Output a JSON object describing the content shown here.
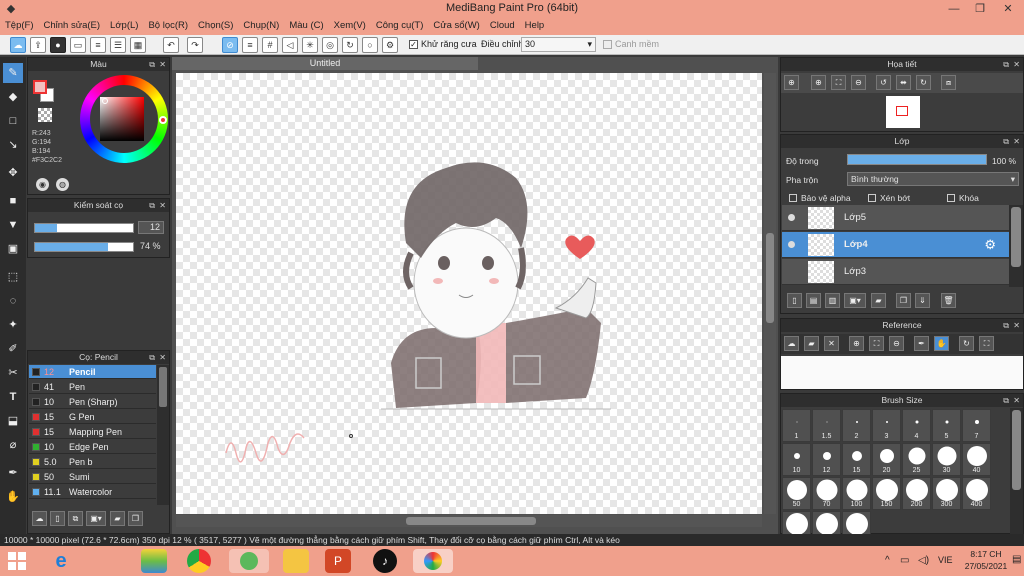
{
  "window": {
    "title": "MediBang Paint Pro (64bit)"
  },
  "menu": [
    "Tệp(F)",
    "Chỉnh sửa(E)",
    "Lớp(L)",
    "Bộ lọc(R)",
    "Chọn(S)",
    "Chụp(N)",
    "Màu (C)",
    "Xem(V)",
    "Công cụ(T)",
    "Cửa sổ(W)",
    "Cloud",
    "Help"
  ],
  "toolbar": {
    "antialias_label": "Khử răng cưa",
    "adjust_label": "Điều chỉnh",
    "adjust_value": "30",
    "smooth_label": "Canh mềm"
  },
  "color_panel": {
    "title": "Màu",
    "r": "R:243",
    "g": "G:194",
    "b": "B:194",
    "hex": "#F3C2C2",
    "fg": "#f3c2c2"
  },
  "brush_control": {
    "title": "Kiểm soát cọ",
    "size": "12",
    "opacity": "74 %"
  },
  "brush_panel": {
    "title": "Cọ: Pencil",
    "items": [
      {
        "size": "12",
        "name": "Pencil",
        "color": "#222222"
      },
      {
        "size": "41",
        "name": "Pen",
        "color": "#222222"
      },
      {
        "size": "10",
        "name": "Pen (Sharp)",
        "color": "#222222"
      },
      {
        "size": "15",
        "name": "G Pen",
        "color": "#e03030"
      },
      {
        "size": "15",
        "name": "Mapping Pen",
        "color": "#e03030"
      },
      {
        "size": "10",
        "name": "Edge Pen",
        "color": "#30b030"
      },
      {
        "size": "5.0",
        "name": "Pen b",
        "color": "#e0d020"
      },
      {
        "size": "50",
        "name": "Sumi",
        "color": "#e0d020"
      },
      {
        "size": "11.1",
        "name": "Watercolor",
        "color": "#60b0f0"
      }
    ]
  },
  "canvas": {
    "tab": "Untitled"
  },
  "navigator": {
    "title": "Họa tiết"
  },
  "layers": {
    "title": "Lớp",
    "opacity_label": "Độ trong",
    "opacity_value": "100 %",
    "blend_label": "Pha trộn",
    "blend_value": "Bình thường",
    "protect_alpha": "Bảo vệ alpha",
    "clipping": "Xén bớt",
    "lock": "Khóa",
    "items": [
      "Lớp5",
      "Lớp4",
      "Lớp3"
    ]
  },
  "reference": {
    "title": "Reference"
  },
  "brush_size": {
    "title": "Brush Size",
    "sizes": [
      "1",
      "1.5",
      "2",
      "3",
      "4",
      "5",
      "7",
      "10",
      "12",
      "15",
      "20",
      "25",
      "30",
      "40",
      "50",
      "70",
      "100",
      "150",
      "200",
      "300",
      "400"
    ]
  },
  "status": "10000 * 10000 pixel   (72.6 * 72.6cm)   350 dpi   12 %   ( 3517, 5277 )   Vẽ một đường thẳng bằng cách giữ phím Shift, Thay đổi cỡ cọ bằng cách giữ phím Ctrl, Alt và kéo",
  "taskbar": {
    "lang": "VIE",
    "time": "8:17 CH",
    "date": "27/05/2021"
  }
}
